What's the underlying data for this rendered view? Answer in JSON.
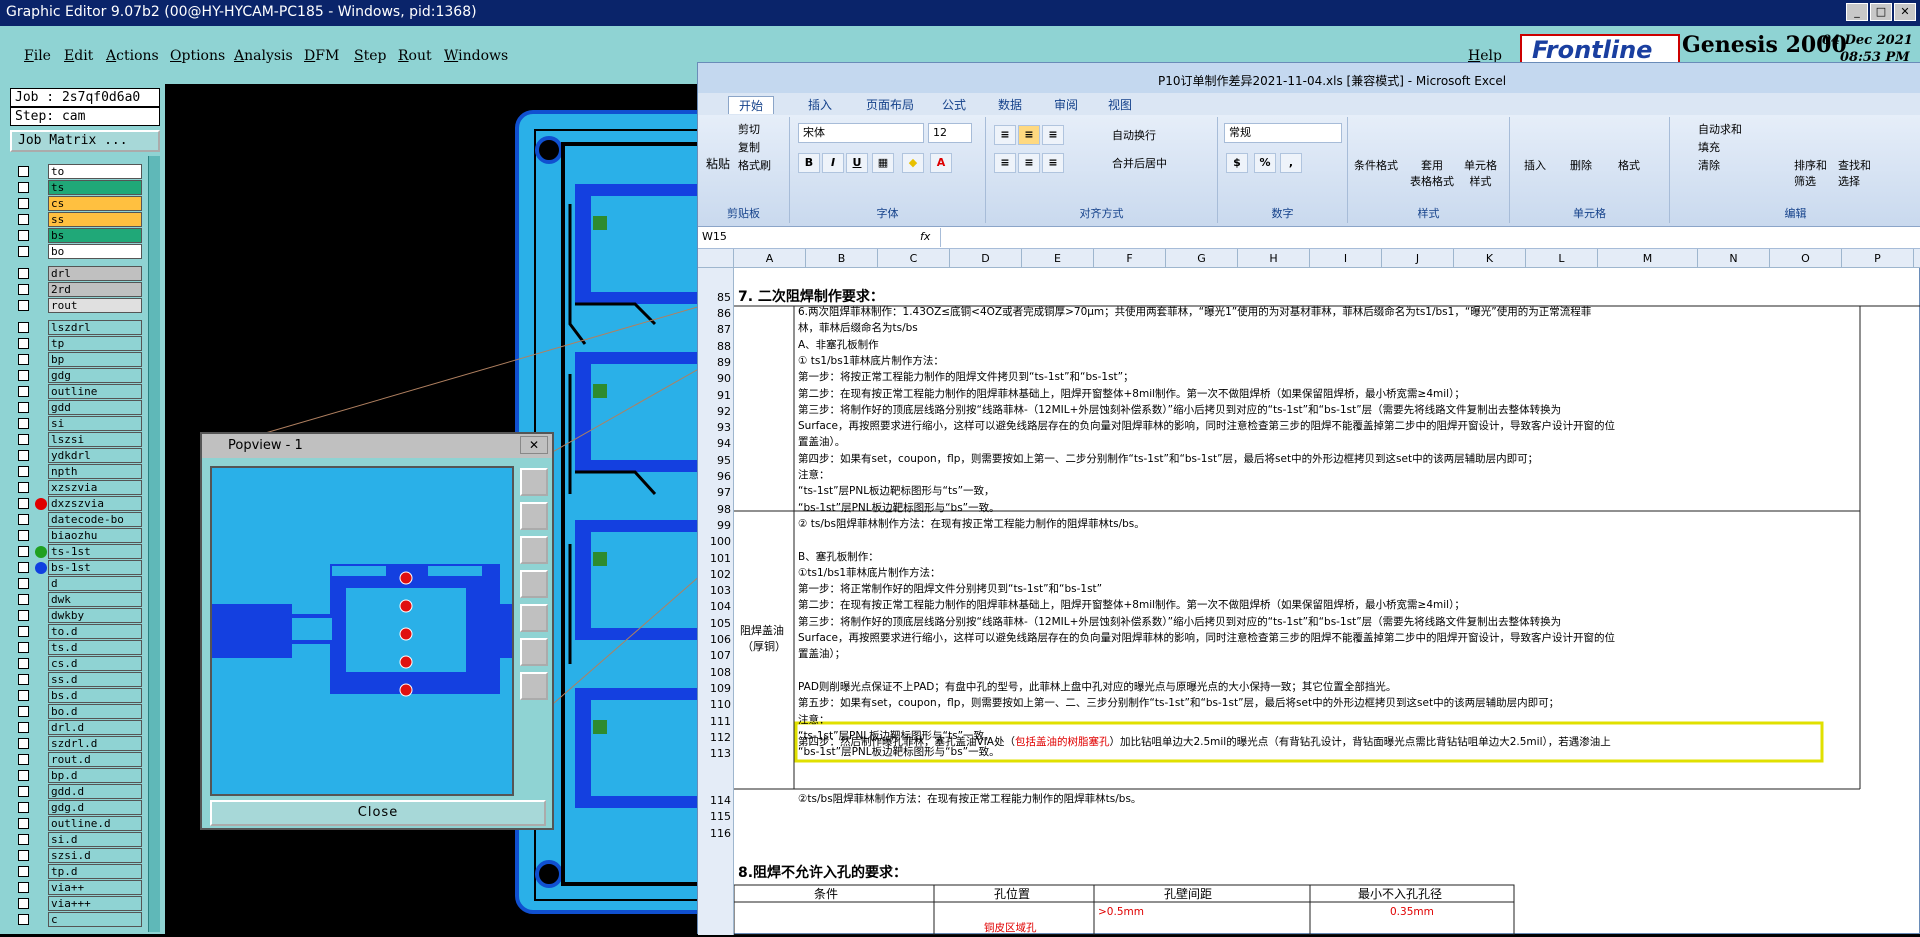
{
  "genesis": {
    "title": "Graphic Editor 9.07b2 (00@HY-HYCAM-PC185 - Windows, pid:1368)",
    "menu": [
      "File",
      "Edit",
      "Actions",
      "Options",
      "Analysis",
      "DFM",
      "Step",
      "Rout",
      "Windows"
    ],
    "help": "Help",
    "logo": "Frontline",
    "product": "Genesis 2000",
    "date": "04 Dec 2021",
    "time": "08:53 PM",
    "job": "Job : 2s7qf0d6a0",
    "step": "Step: cam",
    "job_matrix": "Job Matrix ...",
    "layers": [
      {
        "name": "to",
        "color": "#ffffff"
      },
      {
        "name": "ts",
        "color": "#20a878"
      },
      {
        "name": "cs",
        "color": "#ffc040"
      },
      {
        "name": "ss",
        "color": "#ffc040"
      },
      {
        "name": "bs",
        "color": "#20a878"
      },
      {
        "name": "bo",
        "color": "#ffffff"
      },
      {
        "name": "drl",
        "color": "#c0c0c0"
      },
      {
        "name": "2rd",
        "color": "#c0c0c0"
      },
      {
        "name": "rout",
        "color": "#e0e0e0"
      },
      {
        "name": "lszdrl",
        "color": "#8fd3d3"
      },
      {
        "name": "tp",
        "color": "#8fd3d3"
      },
      {
        "name": "bp",
        "color": "#8fd3d3"
      },
      {
        "name": "gdg",
        "color": "#8fd3d3"
      },
      {
        "name": "outline",
        "color": "#8fd3d3"
      },
      {
        "name": "gdd",
        "color": "#8fd3d3"
      },
      {
        "name": "si",
        "color": "#8fd3d3"
      },
      {
        "name": "lszsi",
        "color": "#8fd3d3"
      },
      {
        "name": "ydkdrl",
        "color": "#8fd3d3"
      },
      {
        "name": "npth",
        "color": "#8fd3d3"
      },
      {
        "name": "xzszvia",
        "color": "#8fd3d3"
      },
      {
        "name": "dxzszvia",
        "color": "#8fd3d3"
      },
      {
        "name": "datecode-bo",
        "color": "#8fd3d3"
      },
      {
        "name": "biaozhu",
        "color": "#8fd3d3"
      },
      {
        "name": "ts-1st",
        "color": "#8fd3d3"
      },
      {
        "name": "bs-1st",
        "color": "#8fd3d3"
      },
      {
        "name": "d",
        "color": "#8fd3d3"
      },
      {
        "name": "dwk",
        "color": "#8fd3d3"
      },
      {
        "name": "dwkby",
        "color": "#8fd3d3"
      },
      {
        "name": "to.d",
        "color": "#8fd3d3"
      },
      {
        "name": "ts.d",
        "color": "#8fd3d3"
      },
      {
        "name": "cs.d",
        "color": "#8fd3d3"
      },
      {
        "name": "ss.d",
        "color": "#8fd3d3"
      },
      {
        "name": "bs.d",
        "color": "#8fd3d3"
      },
      {
        "name": "bo.d",
        "color": "#8fd3d3"
      },
      {
        "name": "drl.d",
        "color": "#8fd3d3"
      },
      {
        "name": "szdrl.d",
        "color": "#8fd3d3"
      },
      {
        "name": "rout.d",
        "color": "#8fd3d3"
      },
      {
        "name": "bp.d",
        "color": "#8fd3d3"
      },
      {
        "name": "gdd.d",
        "color": "#8fd3d3"
      },
      {
        "name": "gdg.d",
        "color": "#8fd3d3"
      },
      {
        "name": "outline.d",
        "color": "#8fd3d3"
      },
      {
        "name": "si.d",
        "color": "#8fd3d3"
      },
      {
        "name": "szsi.d",
        "color": "#8fd3d3"
      },
      {
        "name": "tp.d",
        "color": "#8fd3d3"
      },
      {
        "name": "via++",
        "color": "#8fd3d3"
      },
      {
        "name": "via+++",
        "color": "#8fd3d3"
      },
      {
        "name": "c",
        "color": "#8fd3d3"
      }
    ]
  },
  "popview": {
    "title": "Popview - 1",
    "close": "Close"
  },
  "excel": {
    "title": "P10订单制作差异2021-11-04.xls  [兼容模式] - Microsoft Excel",
    "tabs": [
      "开始",
      "插入",
      "页面布局",
      "公式",
      "数据",
      "审阅",
      "视图"
    ],
    "clipboard": {
      "paste": "粘贴",
      "cut": "剪切",
      "copy": "复制",
      "format_painter": "格式刷",
      "label": "剪贴板"
    },
    "font": {
      "name": "宋体",
      "size": "12",
      "label": "字体"
    },
    "align": {
      "wrap": "自动换行",
      "merge": "合并后居中",
      "label": "对齐方式"
    },
    "number": {
      "format": "常规",
      "label": "数字"
    },
    "styles": {
      "cond": "条件格式",
      "table": "套用\n表格格式",
      "cell": "单元格\n样式",
      "label": "样式"
    },
    "cells": {
      "insert": "插入",
      "delete": "删除",
      "format": "格式",
      "label": "单元格"
    },
    "edit": {
      "autosum": "自动求和",
      "fill": "填充",
      "clear": "清除",
      "sort": "排序和\n筛选",
      "find": "查找和\n选择",
      "label": "编辑"
    },
    "namebox": "W15",
    "fx": "fx",
    "columns": [
      "A",
      "B",
      "C",
      "D",
      "E",
      "F",
      "G",
      "H",
      "I",
      "J",
      "K",
      "L",
      "M",
      "N",
      "O",
      "P"
    ],
    "rows": [
      "85",
      "86",
      "87",
      "88",
      "89",
      "90",
      "91",
      "92",
      "93",
      "94",
      "95",
      "96",
      "97",
      "98",
      "99",
      "100",
      "101",
      "102",
      "103",
      "104",
      "105",
      "106",
      "107",
      "108",
      "109",
      "110",
      "111",
      "112",
      "113",
      "114",
      "115",
      "116"
    ],
    "section7": "7. 二次阻焊制作要求：",
    "label_a": "阻焊盖油",
    "label_b": "（厚铜）",
    "lines": [
      "6.两次阻焊菲林制作：1.43OZ≤底铜<4OZ或者完成铜厚>70μm；共使用两套菲林，“曝光1”使用的为对基材菲林，菲林后缀命名为ts1/bs1，“曝光”使用的为正常流程菲",
      "林，菲林后缀命名为ts/bs",
      "A、非塞孔板制作",
      "① ts1/bs1菲林底片制作方法：",
      "第一步：将按正常工程能力制作的阻焊文件拷贝到“ts-1st”和“bs-1st”；",
      "第二步：在现有按正常工程能力制作的阻焊菲林基础上，阻焊开窗整体+8mil制作。第一次不做阻焊桥（如果保留阻焊桥，最小桥宽需≥4mil）；",
      "第三步：将制作好的顶底层线路分别按“线路菲林-（12MIL+外层蚀刻补偿系数）”缩小后拷贝到对应的“ts-1st”和“bs-1st”层（需要先将线路文件复制出去整体转换为",
      "Surface，再按照要求进行缩小，这样可以避免线路层存在的负向量对阻焊菲林的影响，同时注意检查第三步的阻焊不能覆盖掉第二步中的阻焊开窗设计，导致客户设计开窗的位",
      "置盖油）。",
      "第四步：如果有set，coupon，flp，则需要按如上第一、二步分别制作“ts-1st”和“bs-1st”层，最后将set中的外形边框拷贝到这set中的该两层辅助层内即可；",
      "注意：",
      "“ts-1st”层PNL板边靶标图形与“ts”一致，",
      "“bs-1st”层PNL板边靶标图形与“bs”一致。",
      "② ts/bs阻焊菲林制作方法：在现有按正常工程能力制作的阻焊菲林ts/bs。",
      "",
      "B、塞孔板制作：",
      "①ts1/bs1菲林底片制作方法：",
      "第一步：将正常制作好的阻焊文件分别拷贝到“ts-1st”和“bs-1st”",
      "第二步：在现有按正常工程能力制作的阻焊菲林基础上，阻焊开窗整体+8mil制作。第一次不做阻焊桥（如果保留阻焊桥，最小桥宽需≥4mil）；",
      "第三步：将制作好的顶底层线路分别按“线路菲林-（12MIL+外层蚀刻补偿系数）”缩小后拷贝到对应的“ts-1st”和“bs-1st”层（需要先将线路文件复制出去整体转换为",
      "Surface，再按照要求进行缩小，这样可以避免线路层存在的负向量对阻焊菲林的影响，同时注意检查第三步的阻焊不能覆盖掉第二步中的阻焊开窗设计，导致客户设计开窗的位",
      "置盖油）；",
      "PAD则削曝光点保证不上PAD；有盘中孔的型号，此菲林上盘中孔对应的曝光点与原曝光点的大小保持一致；其它位置全部挡光。",
      "第五步：如果有set，coupon，flp，则需要按如上第一、二、三步分别制作“ts-1st”和“bs-1st”层，最后将set中的外形边框拷贝到这set中的该两层辅助层内即可；",
      "注意：",
      "“ts-1st”层PNL板边靶标图形与“ts”一致，",
      "“bs-1st”层PNL板边靶标图形与“bs”一致。",
      "②ts/bs阻焊菲林制作方法：在现有按正常工程能力制作的阻焊菲林ts/bs。"
    ],
    "step4_a": "第四步：然后制作曝孔菲林，塞孔盖油VIA处（",
    "step4_red": "包括盖油的树脂塞孔",
    "step4_b": "）加比钻咀单边大2.5mil的曝光点（有背钻孔设计，背钻面曝光点需比背钻钻咀单边大2.5mil），若遇渗油上",
    "section8": "8.阻焊不允许入孔的要求：",
    "table_headers": [
      "条件",
      "孔位置",
      "孔壁间距",
      "最小不入孔孔径"
    ],
    "table_row": {
      "pos": "铜皮区域孔",
      "spacing": ">0.5mm",
      "min": "0.35mm"
    }
  }
}
